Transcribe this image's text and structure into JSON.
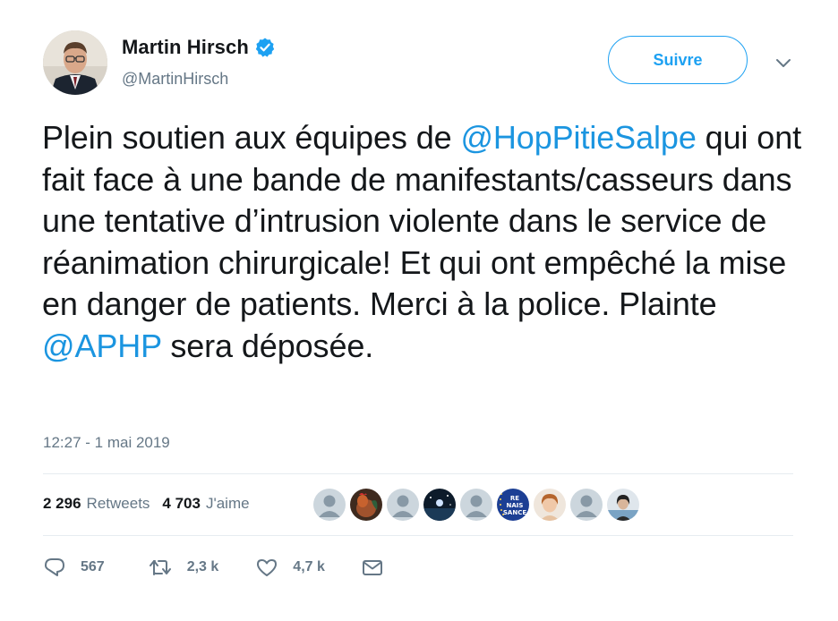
{
  "author": {
    "display_name": "Martin Hirsch",
    "handle": "@MartinHirsch",
    "verified_icon": "verified-badge-icon"
  },
  "follow_button": {
    "label": "Suivre"
  },
  "menu_icon": "chevron-down-icon",
  "tweet": {
    "text_segments": [
      {
        "type": "text",
        "value": "Plein soutien aux équipes de "
      },
      {
        "type": "mention",
        "value": "@HopPitieSalpe"
      },
      {
        "type": "text",
        "value": " qui ont fait face à une bande de manifestants/casseurs dans une tentative d’intrusion violente dans le service de réanimation chirurgicale! Et qui ont empêché la mise en danger de patients. Merci à la police. Plainte "
      },
      {
        "type": "mention",
        "value": "@APHP"
      },
      {
        "type": "text",
        "value": " sera déposée."
      }
    ],
    "timestamp": "12:27 - 1 mai 2019"
  },
  "stats": {
    "retweets_count": "2 296",
    "retweets_label": "Retweets",
    "likes_count": "4 703",
    "likes_label": "J'aime"
  },
  "likers": [
    {
      "kind": "default"
    },
    {
      "kind": "rooster"
    },
    {
      "kind": "default"
    },
    {
      "kind": "night"
    },
    {
      "kind": "default"
    },
    {
      "kind": "renaissance",
      "text_lines": [
        "RE",
        "NAIS",
        "SANCE"
      ]
    },
    {
      "kind": "person-light"
    },
    {
      "kind": "default"
    },
    {
      "kind": "person-dark"
    }
  ],
  "actions": {
    "reply": {
      "icon": "reply-icon",
      "count": "567"
    },
    "retweet": {
      "icon": "retweet-icon",
      "count": "2,3 k"
    },
    "like": {
      "icon": "heart-icon",
      "count": "4,7 k"
    },
    "dm": {
      "icon": "envelope-icon"
    }
  },
  "colors": {
    "accent": "#1da1f2",
    "mention": "#1b95e0",
    "secondary_text": "#657786",
    "border": "#e6ecf0"
  }
}
